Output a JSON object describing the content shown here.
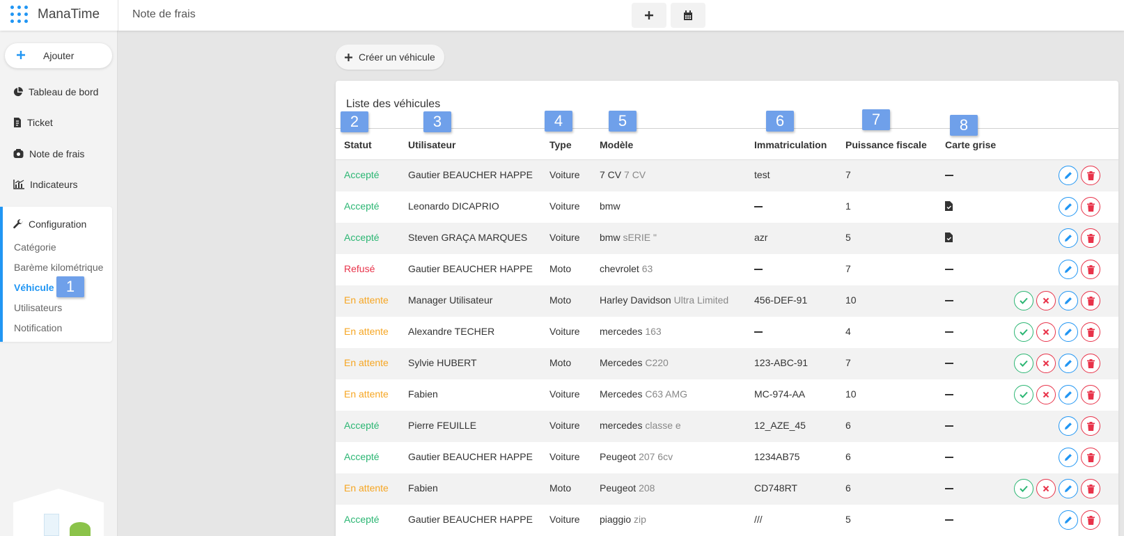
{
  "app": {
    "brand": "ManaTime",
    "page_title": "Note de frais",
    "accent_color": "#2196f3"
  },
  "sidebar": {
    "add_label": "Ajouter",
    "nav": [
      {
        "label": "Tableau de bord",
        "icon": "pie-chart-icon"
      },
      {
        "label": "Ticket",
        "icon": "receipt-icon"
      },
      {
        "label": "Note de frais",
        "icon": "money-bag-icon"
      },
      {
        "label": "Indicateurs",
        "icon": "bar-chart-icon"
      }
    ],
    "config": {
      "title": "Configuration",
      "icon": "wrench-icon",
      "items": [
        {
          "label": "Catégorie"
        },
        {
          "label": "Barème kilométrique"
        },
        {
          "label": "Véhicule",
          "active": true
        },
        {
          "label": "Utilisateurs"
        },
        {
          "label": "Notification"
        }
      ]
    }
  },
  "markers": [
    "1",
    "2",
    "3",
    "4",
    "5",
    "6",
    "7",
    "8"
  ],
  "main": {
    "create_label": "Créer un véhicule",
    "card_title": "Liste des véhicules",
    "columns": [
      "Statut",
      "Utilisateur",
      "Type",
      "Modèle",
      "Immatriculation",
      "Puissance fiscale",
      "Carte grise"
    ],
    "rows": [
      {
        "status": "Accepté",
        "status_kind": "accepted",
        "user": "Gautier BEAUCHER HAPPE",
        "type": "Voiture",
        "brand": "7 CV",
        "model": "7 CV",
        "plate": "test",
        "power": "7",
        "doc": "none",
        "pending": false
      },
      {
        "status": "Accepté",
        "status_kind": "accepted",
        "user": "Leonardo DICAPRIO",
        "type": "Voiture",
        "brand": "bmw",
        "model": "",
        "plate": "",
        "power": "1",
        "doc": "file",
        "pending": false
      },
      {
        "status": "Accepté",
        "status_kind": "accepted",
        "user": "Steven GRAÇA MARQUES",
        "type": "Voiture",
        "brand": "bmw",
        "model": "sERIE \"",
        "plate": "azr",
        "power": "5",
        "doc": "file",
        "pending": false
      },
      {
        "status": "Refusé",
        "status_kind": "refused",
        "user": "Gautier BEAUCHER HAPPE",
        "type": "Moto",
        "brand": "chevrolet",
        "model": "63",
        "plate": "",
        "power": "7",
        "doc": "none",
        "pending": false
      },
      {
        "status": "En attente",
        "status_kind": "pending",
        "user": "Manager Utilisateur",
        "type": "Moto",
        "brand": "Harley Davidson",
        "model": "Ultra Limited",
        "plate": "456-DEF-91",
        "power": "10",
        "doc": "none",
        "pending": true
      },
      {
        "status": "En attente",
        "status_kind": "pending",
        "user": "Alexandre TECHER",
        "type": "Voiture",
        "brand": "mercedes",
        "model": "163",
        "plate": "",
        "power": "4",
        "doc": "none",
        "pending": true
      },
      {
        "status": "En attente",
        "status_kind": "pending",
        "user": "Sylvie HUBERT",
        "type": "Moto",
        "brand": "Mercedes",
        "model": "C220",
        "plate": "123-ABC-91",
        "power": "7",
        "doc": "none",
        "pending": true
      },
      {
        "status": "En attente",
        "status_kind": "pending",
        "user": "Fabien",
        "type": "Voiture",
        "brand": "Mercedes",
        "model": "C63 AMG",
        "plate": "MC-974-AA",
        "power": "10",
        "doc": "none",
        "pending": true
      },
      {
        "status": "Accepté",
        "status_kind": "accepted",
        "user": "Pierre FEUILLE",
        "type": "Voiture",
        "brand": "mercedes",
        "model": "classe e",
        "plate": "12_AZE_45",
        "power": "6",
        "doc": "none",
        "pending": false
      },
      {
        "status": "Accepté",
        "status_kind": "accepted",
        "user": "Gautier BEAUCHER HAPPE",
        "type": "Voiture",
        "brand": "Peugeot",
        "model": "207 6cv",
        "plate": "1234AB75",
        "power": "6",
        "doc": "none",
        "pending": false
      },
      {
        "status": "En attente",
        "status_kind": "pending",
        "user": "Fabien",
        "type": "Moto",
        "brand": "Peugeot",
        "model": "208",
        "plate": "CD748RT",
        "power": "6",
        "doc": "none",
        "pending": true
      },
      {
        "status": "Accepté",
        "status_kind": "accepted",
        "user": "Gautier BEAUCHER HAPPE",
        "type": "Voiture",
        "brand": "piaggio",
        "model": "zip",
        "plate": "///",
        "power": "5",
        "doc": "none",
        "pending": false
      }
    ]
  }
}
